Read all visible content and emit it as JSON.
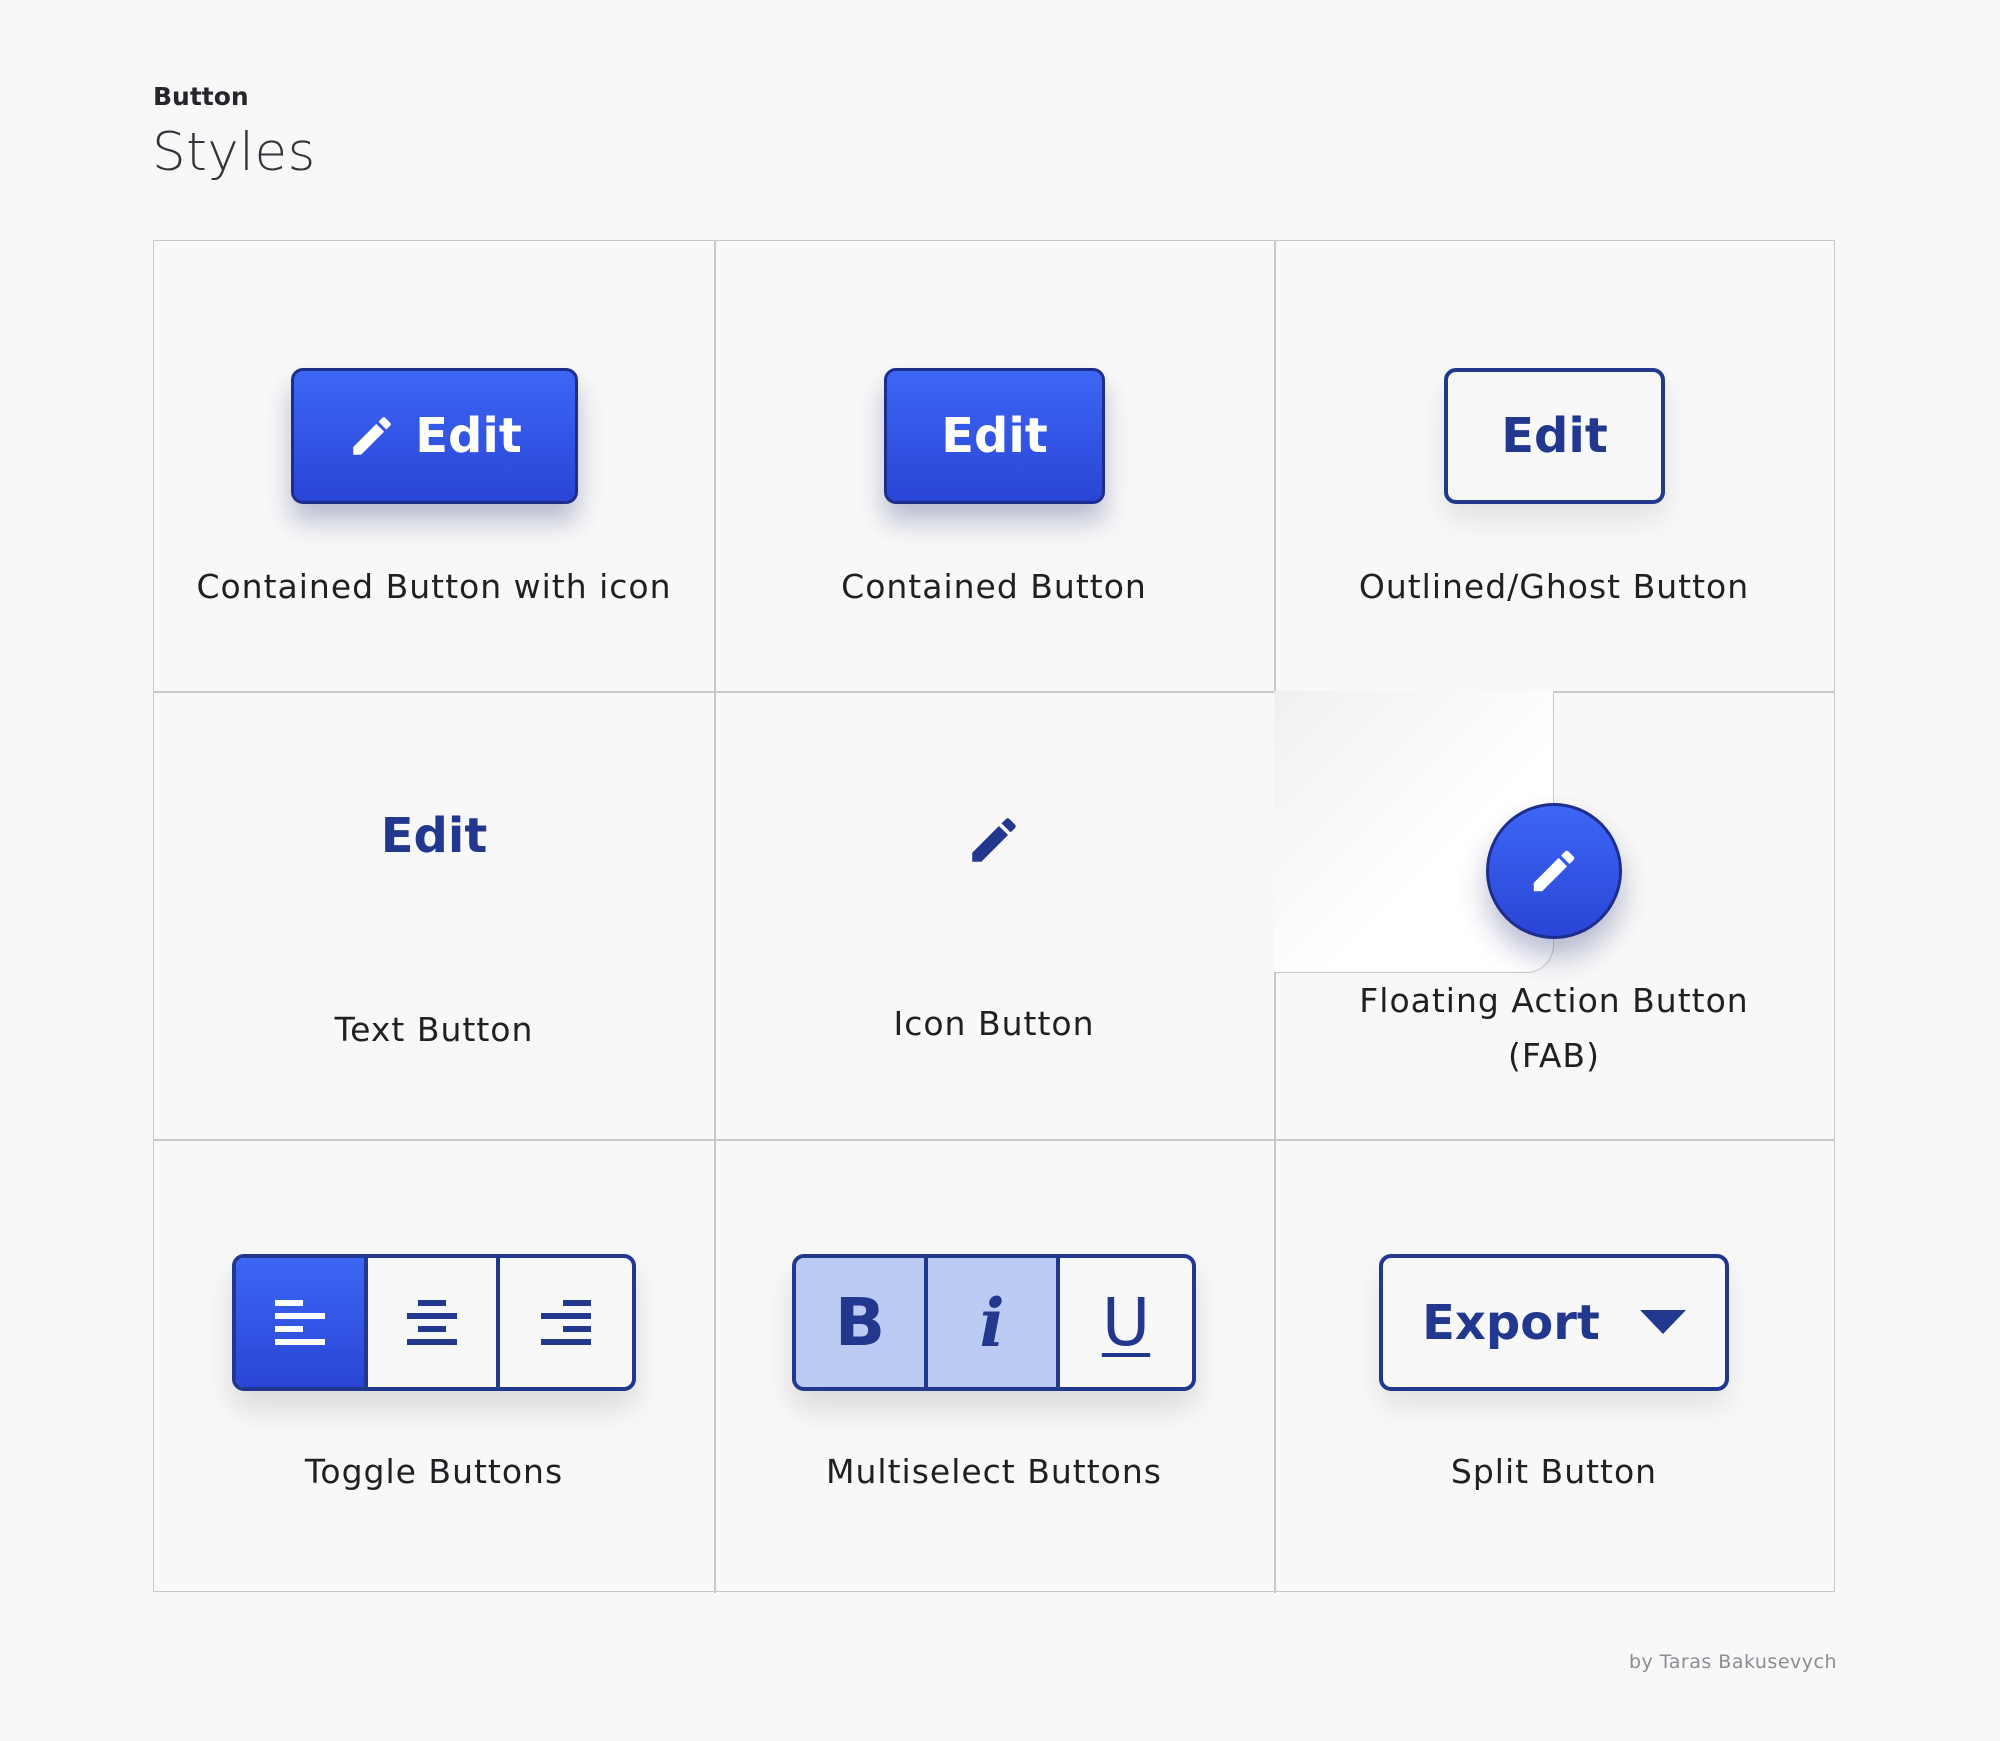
{
  "header": {
    "eyebrow": "Button",
    "title": "Styles"
  },
  "colors": {
    "primary": "#2f52e0",
    "primary_dark": "#22388f",
    "selected_tint": "#bccbf4",
    "background": "#f8f8f8"
  },
  "cells": {
    "contained_icon": {
      "button_label": "Edit",
      "icon": "pencil-icon",
      "caption": "Contained Button with icon"
    },
    "contained": {
      "button_label": "Edit",
      "caption": "Contained Button"
    },
    "outlined": {
      "button_label": "Edit",
      "caption": "Outlined/Ghost Button"
    },
    "text": {
      "button_label": "Edit",
      "caption": "Text Button"
    },
    "icon": {
      "icon": "pencil-icon",
      "caption": "Icon Button"
    },
    "fab": {
      "icon": "pencil-icon",
      "caption_line1": "Floating Action Button",
      "caption_line2": "(FAB)"
    },
    "toggle": {
      "options": [
        "align-left-icon",
        "align-center-icon",
        "align-right-icon"
      ],
      "selected": "align-left-icon",
      "caption": "Toggle Buttons"
    },
    "multiselect": {
      "bold_label": "B",
      "italic_label": "i",
      "underline_label": "U",
      "selected": [
        "B",
        "i"
      ],
      "caption": "Multiselect Buttons"
    },
    "split": {
      "button_label": "Export",
      "icon": "caret-down-icon",
      "caption": "Split Button"
    }
  },
  "footer": {
    "credit": "by Taras Bakusevych"
  }
}
